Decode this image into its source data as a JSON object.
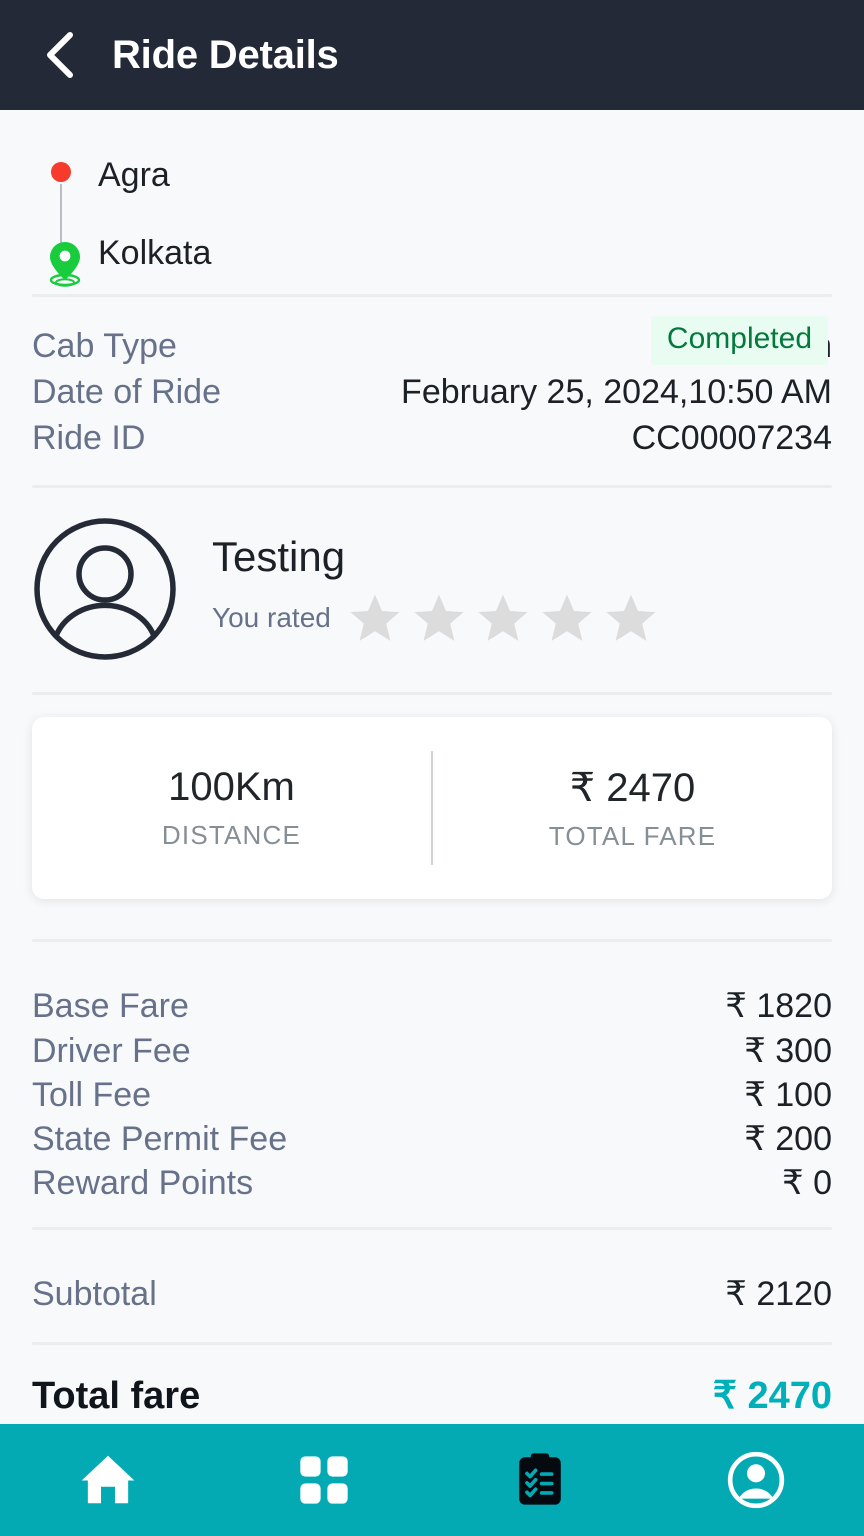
{
  "header": {
    "title": "Ride Details",
    "back_icon": "chevron-left-icon"
  },
  "route": {
    "origin": "Agra",
    "destination": "Kolkata",
    "origin_icon": "origin-dot-icon",
    "destination_icon": "destination-pin-icon",
    "status": "Completed",
    "status_bg": "#e9fcf1",
    "status_color": "#03793d"
  },
  "ride_info": [
    {
      "label": "Cab Type",
      "value": "Sedan"
    },
    {
      "label": "Date of Ride",
      "value": "February 25, 2024,10:50 AM"
    },
    {
      "label": "Ride ID",
      "value": "CC00007234"
    }
  ],
  "driver": {
    "avatar_icon": "user-avatar-icon",
    "name": "Testing",
    "rating_text": "You rated",
    "stars_total": 5,
    "stars_filled": 0,
    "star_empty_color": "#dcdcdc"
  },
  "summary": {
    "distance_value": "100Km",
    "distance_label": "DISTANCE",
    "fare_value": "₹ 2470",
    "fare_label": "TOTAL FARE"
  },
  "fare_breakdown": [
    {
      "label": "Base Fare",
      "value": "₹ 1820"
    },
    {
      "label": "Driver Fee",
      "value": "₹ 300"
    },
    {
      "label": "Toll Fee",
      "value": "₹ 100"
    },
    {
      "label": "State Permit Fee",
      "value": "₹ 200"
    },
    {
      "label": "Reward Points",
      "value": "₹ 0"
    }
  ],
  "subtotal": {
    "label": "Subtotal",
    "value": "₹ 2120"
  },
  "total": {
    "label": "Total fare",
    "value": "₹ 2470",
    "color": "#00b0b8"
  },
  "bottom_nav": [
    {
      "icon": "home-icon",
      "active": false
    },
    {
      "icon": "grid-dashboard-icon",
      "active": false
    },
    {
      "icon": "clipboard-list-icon",
      "active": true
    },
    {
      "icon": "profile-icon",
      "active": false
    }
  ],
  "colors": {
    "header_bg": "#232936",
    "page_bg": "#f8f9fa",
    "nav_bg": "#03aab4",
    "accent_teal": "#00b0b8",
    "label_grey": "#67718a",
    "value_dark": "#1c2027"
  }
}
